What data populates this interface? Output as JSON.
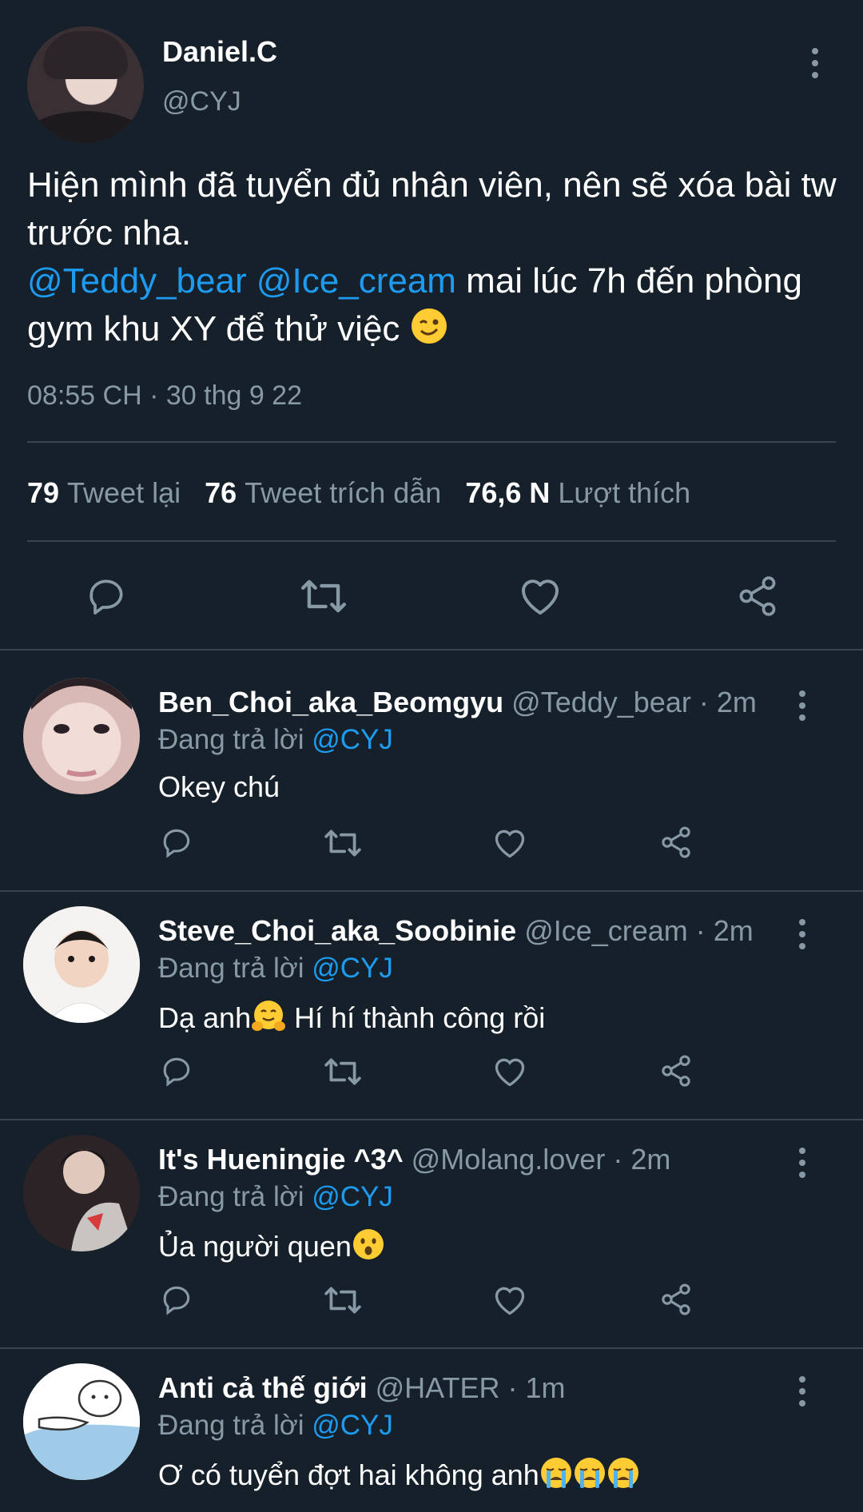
{
  "main": {
    "name": "Daniel.C",
    "handle": "@CYJ",
    "text_line1": "Hiện mình đã tuyển đủ nhân viên, nên sẽ xóa bài tw trước nha.",
    "mention1": "@Teddy_bear",
    "mention2": "@Ice_cream",
    "text_line2": " mai lúc 7h đến phòng gym khu XY để thử việc ",
    "timestamp": "08:55 CH · 30 thg 9 22",
    "stats": [
      {
        "num": "79",
        "label": "Tweet lại"
      },
      {
        "num": "76",
        "label": "Tweet trích dẫn"
      },
      {
        "num": "76,6 N",
        "label": "Lượt thích"
      }
    ]
  },
  "icons": {
    "reply": "reply-icon",
    "retweet": "retweet-icon",
    "like": "heart-icon",
    "share": "share-icon",
    "more": "more-vertical-icon"
  },
  "colors": {
    "background": "#15202b",
    "divider": "#38444d",
    "secondary_text": "#8899a6",
    "accent": "#1d9bf0"
  },
  "replies": [
    {
      "name": "Ben_Choi_aka_Beomgyu",
      "handle": "@Teddy_bear · 2m",
      "replying": "Đang trả lời ",
      "replying_to": "@CYJ",
      "text": "Okey chú"
    },
    {
      "name": "Steve_Choi_aka_Soobinie",
      "handle": "@Ice_cream · 2m",
      "replying": "Đang trả lời ",
      "replying_to": "@CYJ",
      "text_before": "Dạ anh",
      "text_after": " Hí hí thành công rồi"
    },
    {
      "name": "It's Hueningie ^3^",
      "handle": "@Molang.lover · 2m",
      "replying": "Đang trả lời ",
      "replying_to": "@CYJ",
      "text": "Ủa người quen"
    },
    {
      "name": "Anti cả thế giới",
      "handle": "@HATER · 1m",
      "replying": "Đang trả lời ",
      "replying_to": "@CYJ",
      "text": "Ơ có tuyển đợt hai không anh"
    }
  ]
}
